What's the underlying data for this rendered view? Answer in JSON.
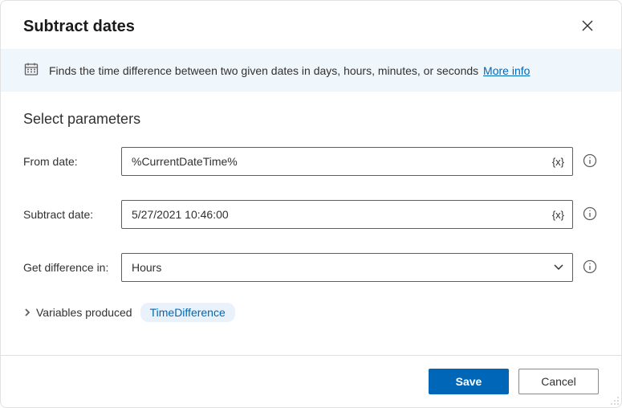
{
  "dialog": {
    "title": "Subtract dates"
  },
  "banner": {
    "text": "Finds the time difference between two given dates in days, hours, minutes, or seconds",
    "link_label": "More info"
  },
  "section": {
    "title": "Select parameters"
  },
  "fields": {
    "from": {
      "label": "From date:",
      "value": "%CurrentDateTime%",
      "token": "{x}"
    },
    "subtract": {
      "label": "Subtract date:",
      "value": "5/27/2021 10:46:00",
      "token": "{x}"
    },
    "diff": {
      "label": "Get difference in:",
      "value": "Hours"
    }
  },
  "vars": {
    "label": "Variables produced",
    "chip": "TimeDifference"
  },
  "footer": {
    "save": "Save",
    "cancel": "Cancel"
  }
}
